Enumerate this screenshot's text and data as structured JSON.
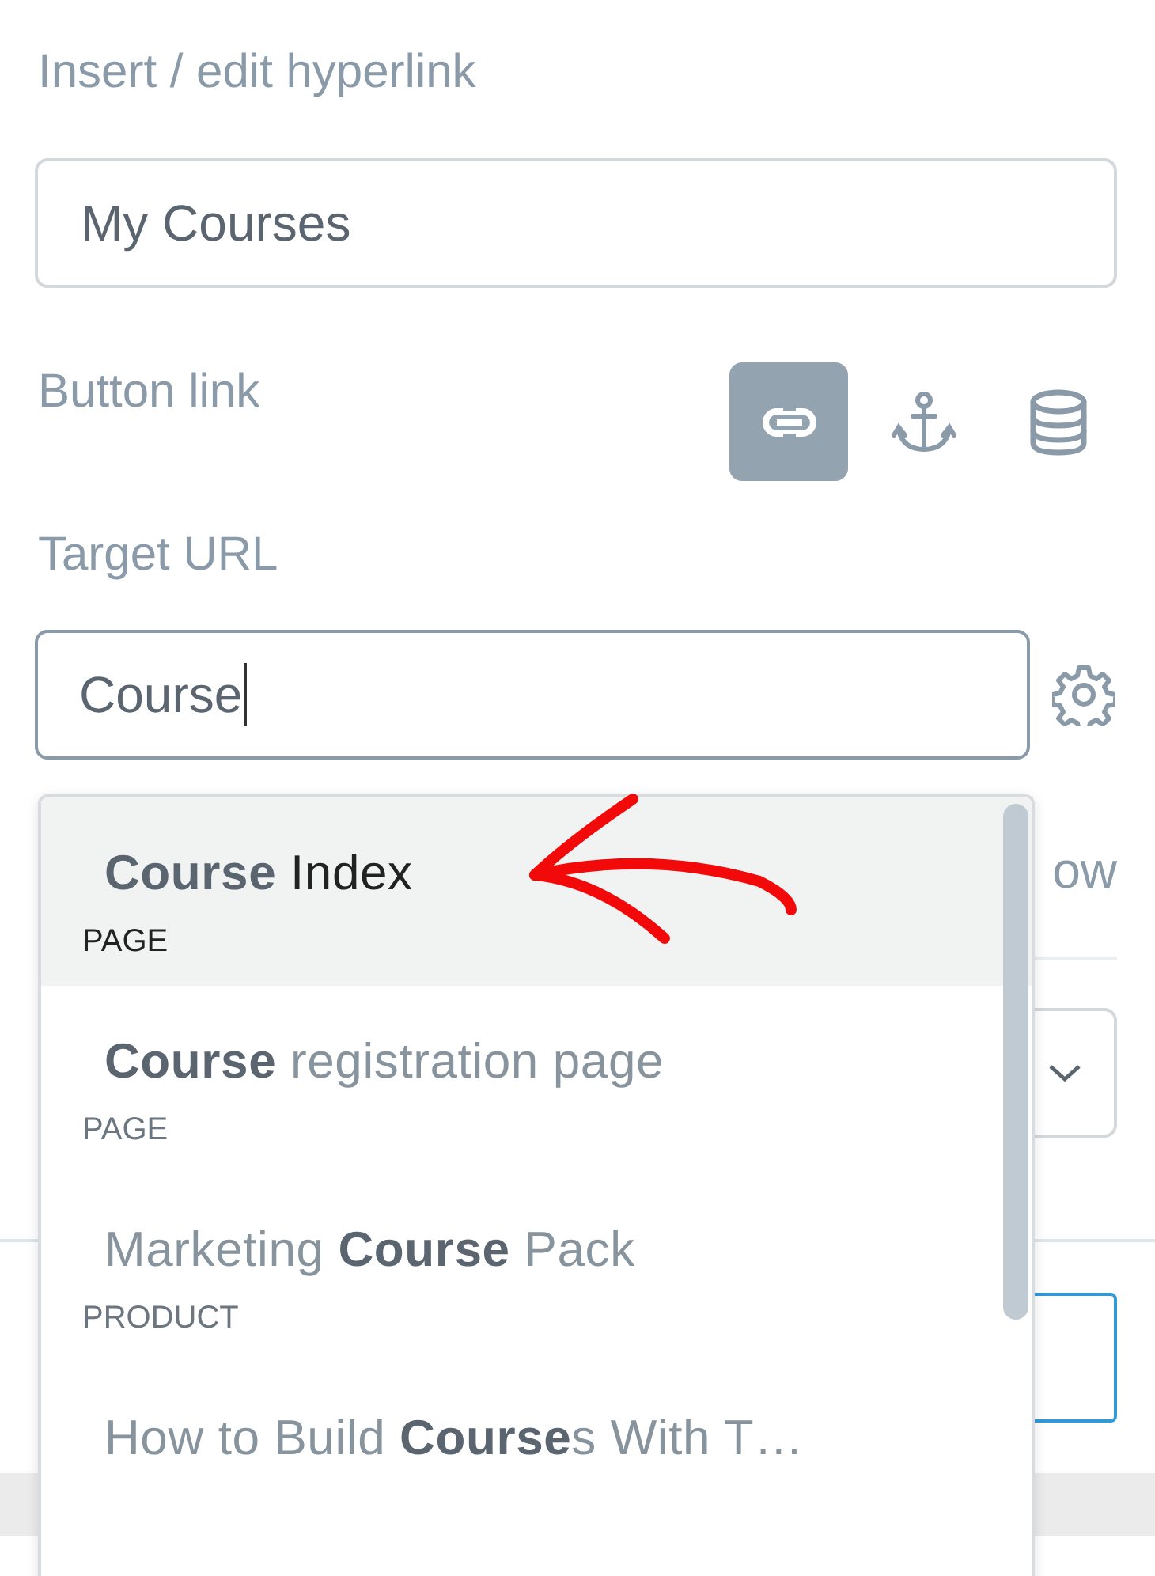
{
  "dialog": {
    "title": "Insert / edit hyperlink"
  },
  "text_field": {
    "value": "My Courses"
  },
  "link_type": {
    "label": "Button link",
    "options": [
      {
        "kind": "url",
        "selected": true
      },
      {
        "kind": "anchor",
        "selected": false
      },
      {
        "kind": "database",
        "selected": false
      }
    ]
  },
  "target_url": {
    "label": "Target URL",
    "value": "Course"
  },
  "suggestions": [
    {
      "title": "**Course** Index",
      "type": "PAGE",
      "selected": true
    },
    {
      "title": "**Course** registration page",
      "type": "PAGE",
      "selected": false
    },
    {
      "title": "Marketing **Course** Pack",
      "type": "PRODUCT",
      "selected": false
    },
    {
      "title": "How to Build **Course**s With T…",
      "selected": false
    }
  ],
  "covered_label": "ow"
}
